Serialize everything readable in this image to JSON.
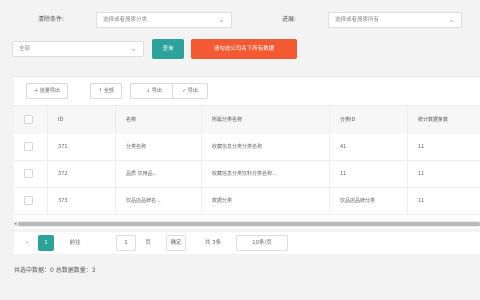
{
  "filters": {
    "field1_label": "清除条件:",
    "field1_value": "选择或者搜索分类",
    "field2_label": "进展:",
    "field2_value": "选择或者搜索所有",
    "field3_value": "全部"
  },
  "actions": {
    "search_label": "查询",
    "export_label": "请勾选公司名下所有数据"
  },
  "toolbar": {
    "buttons": [
      "+ 批量导出",
      "↑ 全部",
      "↓ 导出",
      "✓ 导出"
    ]
  },
  "table": {
    "columns": [
      "ID",
      "名称",
      "所属分类名称",
      "分类ID",
      "统计数据条数"
    ],
    "rows": [
      [
        "371",
        "分类名称",
        "收藏信息分类分类名称",
        "41",
        "11"
      ],
      [
        "372",
        "品质 饮用品...",
        "收藏信息分类饮料分类名称...",
        "11",
        "11"
      ],
      [
        "373",
        "饮品店品牌名...",
        "数据分类",
        "饮品店品牌分类",
        "11"
      ]
    ]
  },
  "pagination": {
    "prev": "‹",
    "current_page": "1",
    "goto_label": "前往",
    "goto_value": "1",
    "page_unit": "页",
    "confirm_label": "确定",
    "total_text": "共 3条",
    "page_size": "10条/页"
  },
  "footer": {
    "summary": "共选中数据：0 总数据数量：3"
  },
  "colors": {
    "teal": "#2ba39b",
    "orange": "#f35a33"
  }
}
